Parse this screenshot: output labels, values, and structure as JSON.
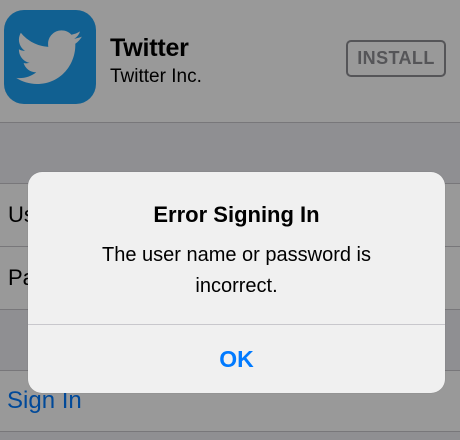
{
  "app": {
    "name": "Twitter",
    "developer": "Twitter Inc.",
    "install_label": "INSTALL",
    "icon": "twitter-bird-icon",
    "brand_color": "#1da1f2"
  },
  "form": {
    "username_label": "User Name",
    "password_label": "Password"
  },
  "sign_in_label": "Sign In",
  "alert": {
    "title": "Error Signing In",
    "message": "The user name or password is incorrect.",
    "ok_label": "OK"
  },
  "colors": {
    "accent": "#007aff",
    "background": "#efeff4"
  }
}
